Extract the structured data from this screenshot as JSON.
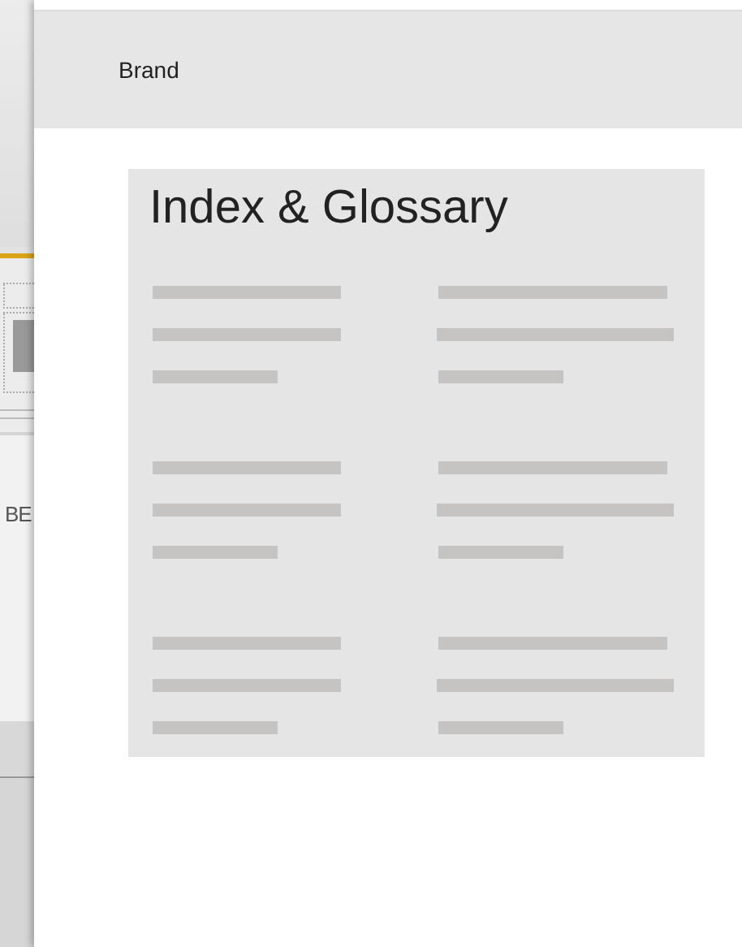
{
  "background_page": {
    "label": "BE"
  },
  "header": {
    "brand": "Brand"
  },
  "card": {
    "title": "Index & Glossary"
  }
}
